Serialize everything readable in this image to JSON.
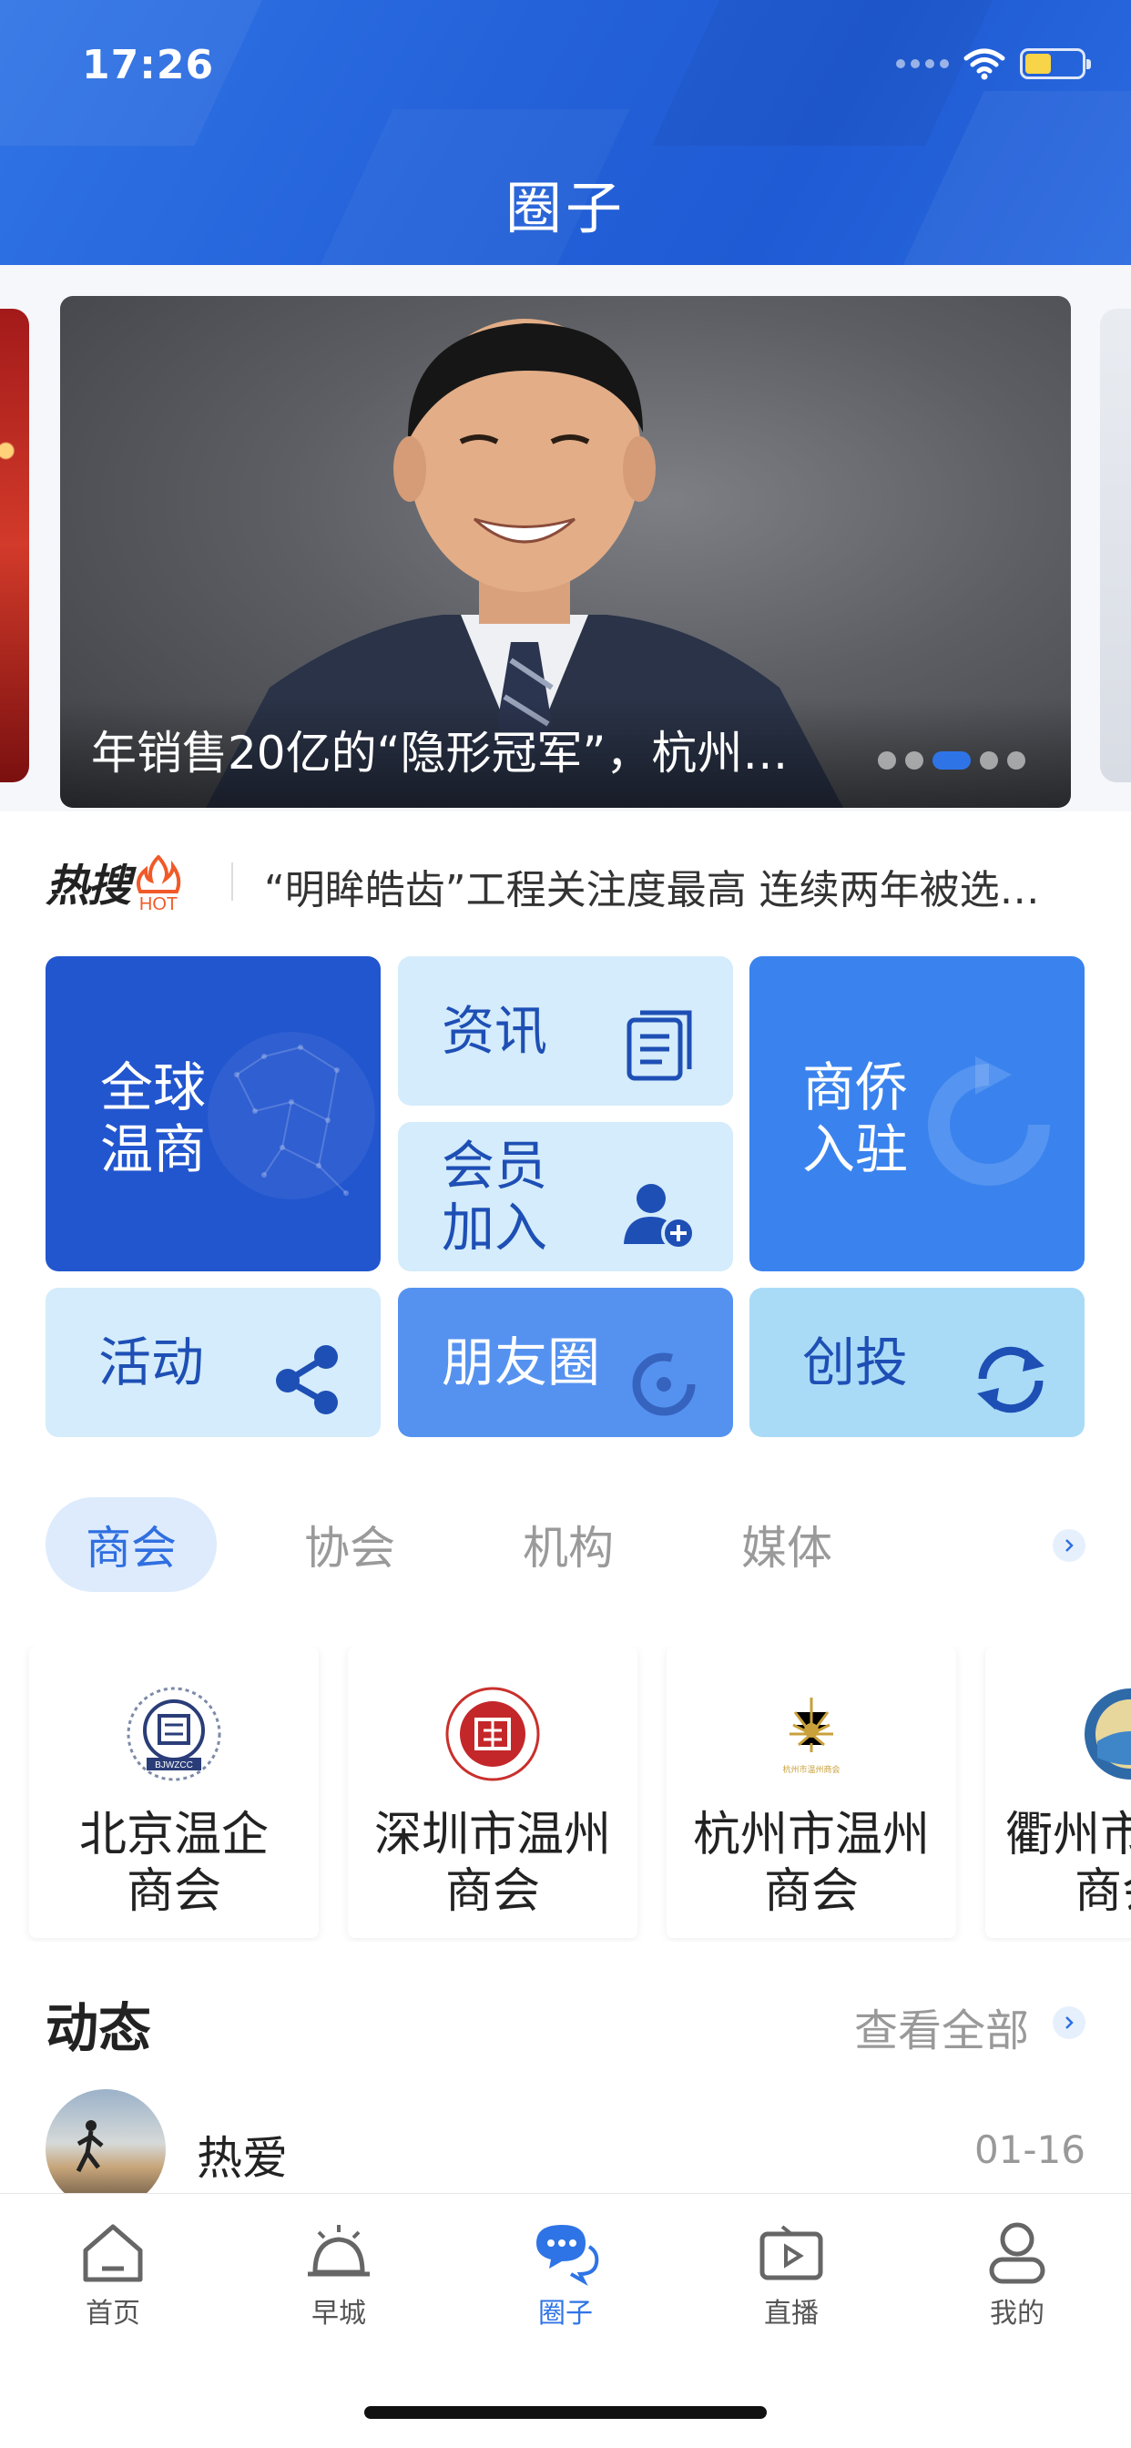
{
  "status_bar": {
    "time": "17:26"
  },
  "header": {
    "title": "圈子"
  },
  "carousel": {
    "caption": "年销售20亿的“隐形冠军”，杭州…",
    "dots_total": 5,
    "active_dot": 3
  },
  "hot_search": {
    "logo_text": "热搜",
    "hot_badge": "HOT",
    "text": "“明眸皓齿”工程关注度最高 连续两年被选…"
  },
  "grid": {
    "global_line1": "全球",
    "global_line2": "温商",
    "news": "资讯",
    "member_line1": "会员",
    "member_line2": "加入",
    "qiao_line1": "商侨",
    "qiao_line2": "入驻",
    "activity": "活动",
    "friends": "朋友圈",
    "invest": "创投"
  },
  "tabs": [
    {
      "label": "商会",
      "active": true
    },
    {
      "label": "协会",
      "active": false
    },
    {
      "label": "机构",
      "active": false
    },
    {
      "label": "媒体",
      "active": false
    }
  ],
  "orgs": [
    {
      "line1": "北京温企",
      "line2": "商会",
      "logo_text": "BJWZCC"
    },
    {
      "line1": "深圳市温州",
      "line2": "商会"
    },
    {
      "line1": "杭州市温州",
      "line2": "商会",
      "logo_text": "杭州市温州商会"
    },
    {
      "line1": "衢州市",
      "line2": "商会"
    }
  ],
  "dynamics": {
    "title": "动态",
    "view_all": "查看全部",
    "post": {
      "user": "热爱",
      "date": "01-16"
    }
  },
  "bottom_nav": [
    {
      "label": "首页",
      "icon": "home-icon",
      "active": false
    },
    {
      "label": "早城",
      "icon": "alarm-bell-icon",
      "active": false
    },
    {
      "label": "圈子",
      "icon": "chat-bubble-icon",
      "active": true
    },
    {
      "label": "直播",
      "icon": "live-tv-icon",
      "active": false
    },
    {
      "label": "我的",
      "icon": "user-icon",
      "active": false
    }
  ],
  "colors": {
    "brand_blue": "#2f74e6",
    "tile_dark": "#2256cf",
    "tile_light": "#d4ecfb",
    "hot_orange": "#f05a28"
  }
}
